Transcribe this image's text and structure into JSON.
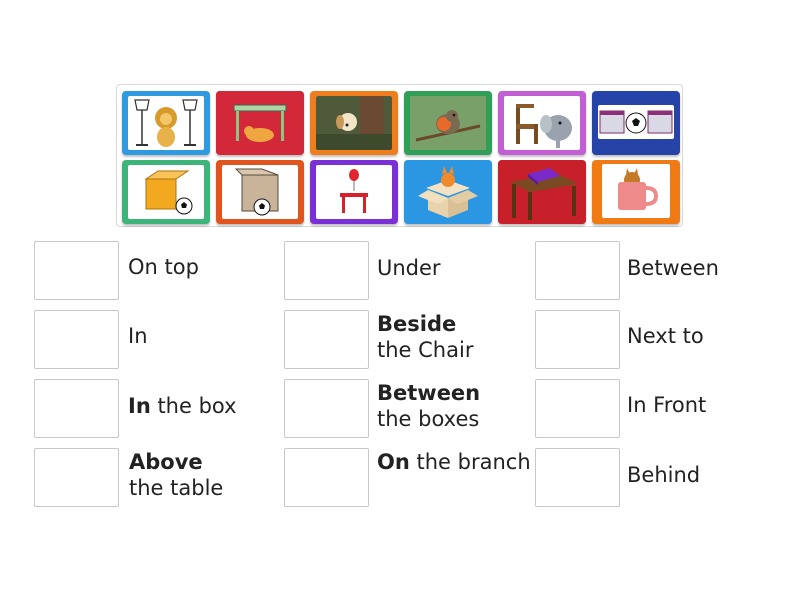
{
  "tiles": [
    {
      "name": "lion-between-lamps-card",
      "color": "#2f9ae0"
    },
    {
      "name": "dog-under-table-card",
      "color": "#d2283a"
    },
    {
      "name": "dog-behind-tree-card",
      "color": "#ef7d1e"
    },
    {
      "name": "bird-on-branch-card",
      "color": "#2f9e57"
    },
    {
      "name": "chair-next-to-elephant-card",
      "color": "#c25fd4"
    },
    {
      "name": "ball-between-boxes-card",
      "color": "#2643a8"
    },
    {
      "name": "ball-beside-box-card",
      "color": "#3db57a"
    },
    {
      "name": "ball-in-front-of-box-card",
      "color": "#e0551e"
    },
    {
      "name": "balloon-above-table-card",
      "color": "#7b30d6"
    },
    {
      "name": "fox-in-box-card",
      "color": "#2b97e3"
    },
    {
      "name": "book-on-table-card",
      "color": "#c8202b"
    },
    {
      "name": "cat-in-mug-card",
      "color": "#f07a14"
    }
  ],
  "rows": [
    [
      {
        "bold": "",
        "rest": "On top"
      },
      {
        "bold": "",
        "rest": "Under"
      },
      {
        "bold": "",
        "rest": "Between"
      }
    ],
    [
      {
        "bold": "",
        "rest": "In"
      },
      {
        "bold": "Beside",
        "rest": "the Chair"
      },
      {
        "bold": "",
        "rest": "Next to"
      }
    ],
    [
      {
        "bold": "In",
        "rest": " the box"
      },
      {
        "bold": "Between",
        "rest": "the boxes"
      },
      {
        "bold": "",
        "rest": "In Front"
      }
    ],
    [
      {
        "bold": "Above",
        "rest": "the table"
      },
      {
        "bold": "On",
        "rest": " the branch"
      },
      {
        "bold": "",
        "rest": "Behind"
      }
    ]
  ]
}
